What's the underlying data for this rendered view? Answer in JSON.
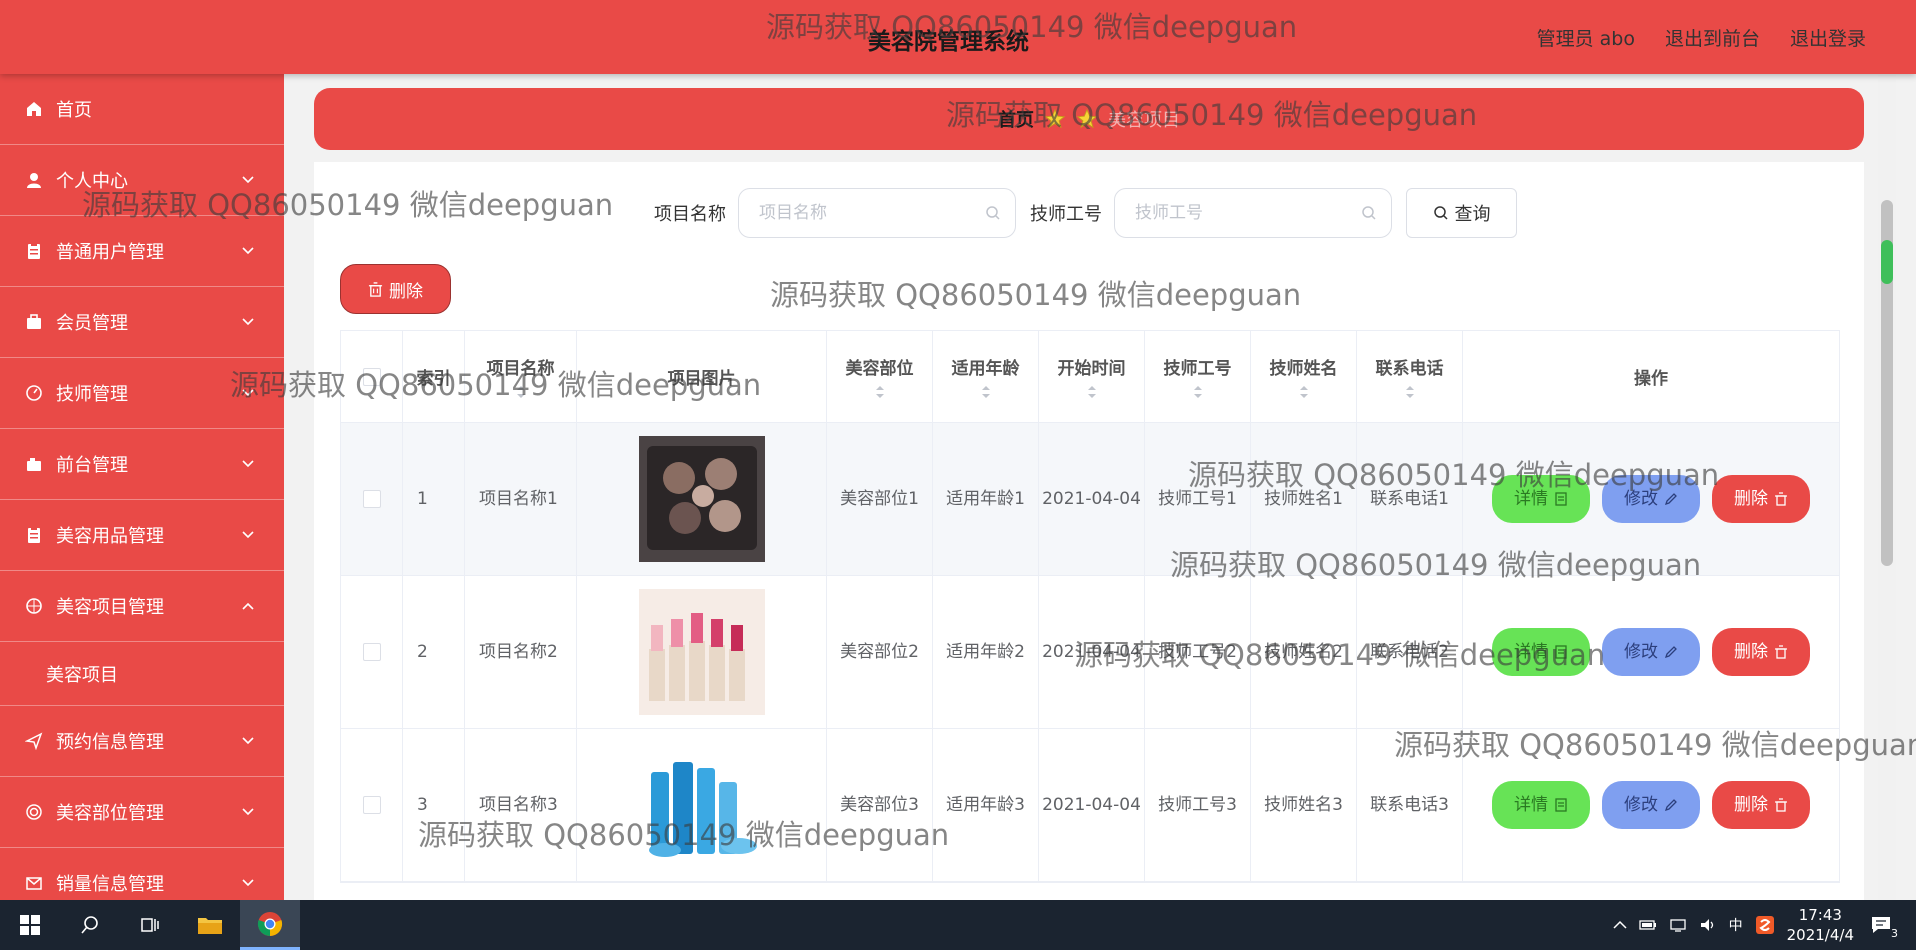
{
  "header": {
    "title": "美容院管理系统",
    "admin_label": "管理员 abo",
    "front_label": "退出到前台",
    "logout_label": "退出登录"
  },
  "sidebar": {
    "items": [
      {
        "label": "首页",
        "icon": "home-icon"
      },
      {
        "label": "个人中心",
        "icon": "user-icon"
      },
      {
        "label": "普通用户管理",
        "icon": "clipboard-icon"
      },
      {
        "label": "会员管理",
        "icon": "briefcase-icon"
      },
      {
        "label": "技师管理",
        "icon": "gauge-icon"
      },
      {
        "label": "前台管理",
        "icon": "camera-icon"
      },
      {
        "label": "美容用品管理",
        "icon": "clipboard-icon"
      },
      {
        "label": "美容项目管理",
        "icon": "aperture-icon"
      },
      {
        "label": "美容项目",
        "icon": ""
      },
      {
        "label": "预约信息管理",
        "icon": "send-icon"
      },
      {
        "label": "美容部位管理",
        "icon": "target-icon"
      },
      {
        "label": "销量信息管理",
        "icon": "mail-icon"
      }
    ]
  },
  "breadcrumb": {
    "home": "首页",
    "current": "美容项目"
  },
  "search": {
    "name_label": "项目名称",
    "name_placeholder": "项目名称",
    "tech_label": "技师工号",
    "tech_placeholder": "技师工号",
    "query_label": "查询"
  },
  "actions": {
    "batch_delete": "删除"
  },
  "table": {
    "headers": [
      "索引",
      "项目名称",
      "项目图片",
      "美容部位",
      "适用年龄",
      "开始时间",
      "技师工号",
      "技师姓名",
      "联系电话",
      "操作"
    ],
    "rows": [
      {
        "index": "1",
        "name": "项目名称1",
        "part": "美容部位1",
        "age": "适用年龄1",
        "start": "2021-04-04",
        "tech_no": "技师工号1",
        "tech_name": "技师姓名1",
        "phone": "联系电话1"
      },
      {
        "index": "2",
        "name": "项目名称2",
        "part": "美容部位2",
        "age": "适用年龄2",
        "start": "2021-04-04",
        "tech_no": "技师工号2",
        "tech_name": "技师姓名2",
        "phone": "联系电话2"
      },
      {
        "index": "3",
        "name": "项目名称3",
        "part": "美容部位3",
        "age": "适用年龄3",
        "start": "2021-04-04",
        "tech_no": "技师工号3",
        "tech_name": "技师姓名3",
        "phone": "联系电话3"
      }
    ],
    "buttons": {
      "detail": "详情",
      "edit": "修改",
      "delete": "删除"
    }
  },
  "watermark": "源码获取 QQ86050149 微信deepguan",
  "taskbar": {
    "time": "17:43",
    "date": "2021/4/4",
    "ime": "中",
    "notifications": "3"
  },
  "colors": {
    "primary": "#e94a47",
    "detail": "#67e356",
    "edit": "#7f9ff0"
  }
}
